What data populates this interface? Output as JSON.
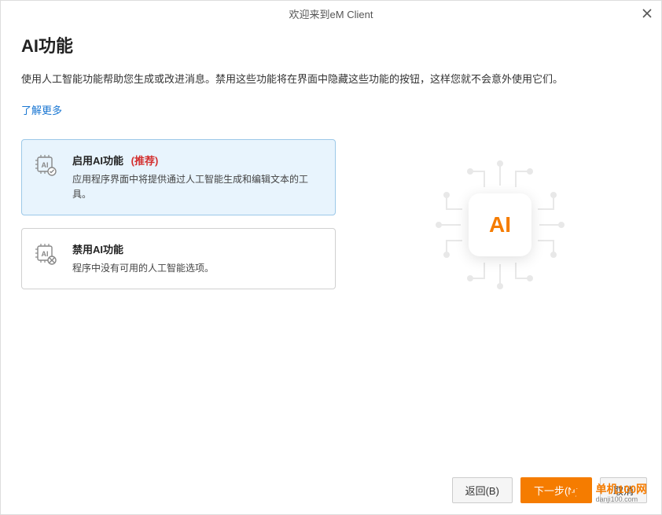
{
  "window": {
    "title": "欢迎来到eM Client"
  },
  "page": {
    "title": "AI功能",
    "description": "使用人工智能功能帮助您生成或改进消息。禁用这些功能将在界面中隐藏这些功能的按钮，这样您就不会意外使用它们。",
    "learn_more": "了解更多"
  },
  "options": {
    "enable": {
      "title": "启用AI功能",
      "recommended": "(推荐)",
      "description": "应用程序界面中将提供通过人工智能生成和编辑文本的工具。"
    },
    "disable": {
      "title": "禁用AI功能",
      "description": "程序中没有可用的人工智能选项。"
    }
  },
  "illustration": {
    "label": "AI"
  },
  "footer": {
    "back": "返回(B)",
    "next": "下一步(N)",
    "cancel": "取消"
  },
  "watermark": {
    "title": "单机100网",
    "sub": "danji100.com"
  }
}
